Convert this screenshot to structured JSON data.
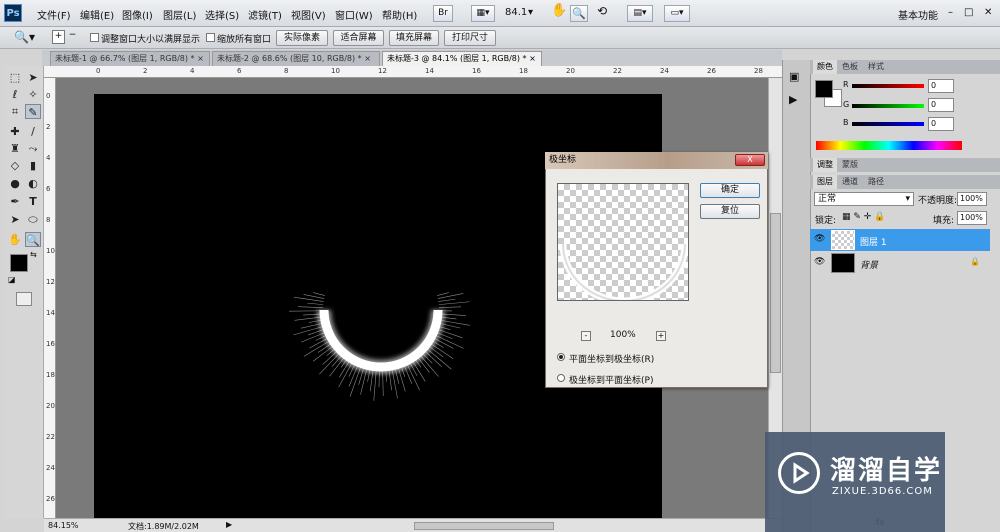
{
  "menubar": {
    "logo": "Ps",
    "items": [
      "文件(F)",
      "编辑(E)",
      "图像(I)",
      "图层(L)",
      "选择(S)",
      "滤镜(T)",
      "视图(V)",
      "窗口(W)",
      "帮助(H)"
    ],
    "bridge_label": "Br",
    "zoom_value": "84.1",
    "workspace": "基本功能",
    "window_controls": [
      "–",
      "□",
      "✕"
    ]
  },
  "options": {
    "checkbox1": "调整窗口大小以满屏显示",
    "checkbox2": "缩放所有窗口",
    "btn_actual": "实际像素",
    "btn_fit": "适合屏幕",
    "btn_fill": "填充屏幕",
    "btn_print": "打印尺寸"
  },
  "tabs": [
    {
      "label": "未标题-1 @ 66.7% (图层 1, RGB/8) *",
      "close": "×"
    },
    {
      "label": "未标题-2 @ 68.6% (图层 10, RGB/8) *",
      "close": "×"
    },
    {
      "label": "未标题-3 @ 84.1% (图层 1, RGB/8) *",
      "close": "×"
    }
  ],
  "ruler_top": [
    "0",
    "2",
    "4",
    "6",
    "8",
    "10",
    "12",
    "14",
    "16",
    "18",
    "20",
    "22",
    "24",
    "26",
    "28"
  ],
  "ruler_left": [
    "0",
    "2",
    "4",
    "6",
    "8",
    "10",
    "12",
    "14",
    "16",
    "18",
    "20",
    "22",
    "24",
    "26"
  ],
  "status": {
    "zoom": "84.15%",
    "doc": "文档:1.89M/2.02M"
  },
  "color_panel": {
    "tabs": [
      "颜色",
      "色板",
      "样式"
    ],
    "labels": [
      "R",
      "G",
      "B"
    ],
    "values": [
      "0",
      "0",
      "0"
    ]
  },
  "adjust_tabs": [
    "调整",
    "蒙版"
  ],
  "layers_panel": {
    "tabs": [
      "图层",
      "通道",
      "路径"
    ],
    "blend_mode": "正常",
    "opacity_label": "不透明度:",
    "opacity": "100%",
    "lock_label": "锁定:",
    "fill_label": "填充:",
    "fill": "100%",
    "layers": [
      {
        "name": "图层 1",
        "selected": true
      },
      {
        "name": "背景",
        "selected": false
      }
    ],
    "footer_icons": [
      "fx"
    ]
  },
  "dialog": {
    "title": "极坐标",
    "close": "X",
    "ok": "确定",
    "reset": "复位",
    "zoom": "100%",
    "minus": "-",
    "plus": "+",
    "option1": "平面坐标到极坐标(R)",
    "option2": "极坐标到平面坐标(P)",
    "selected_option": 1
  },
  "watermark": {
    "text": "溜溜自学",
    "sub": "ZIXUE.3D66.COM"
  }
}
